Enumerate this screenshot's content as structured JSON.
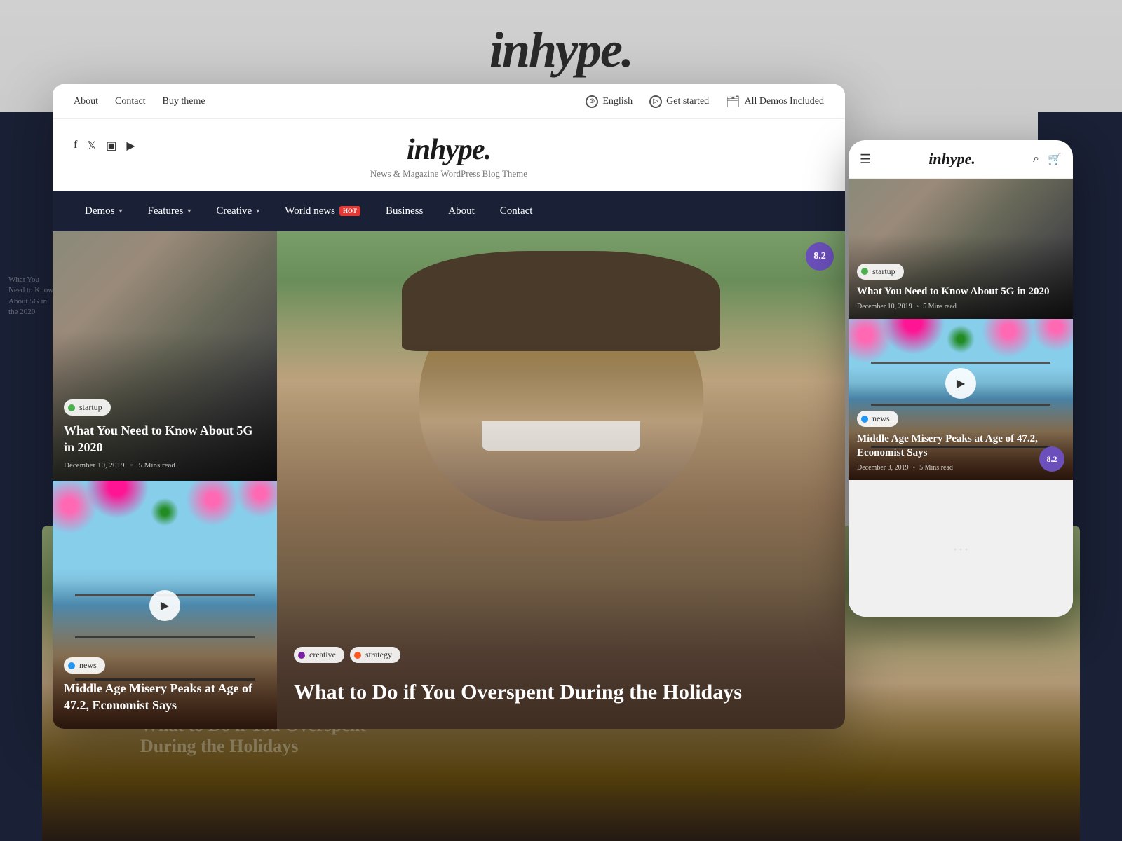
{
  "site": {
    "title": "inhype.",
    "tagline": "News & Magazine WordPress Blog Theme"
  },
  "background": {
    "title": "inhype.",
    "subtitle": "News & Magazine WordPress Blog Theme"
  },
  "utility_bar": {
    "links": [
      "About",
      "Contact",
      "Buy theme"
    ],
    "right_items": [
      {
        "icon": "globe-icon",
        "label": "English"
      },
      {
        "icon": "play-icon",
        "label": "Get started"
      },
      {
        "icon": "folder-icon",
        "label": "All Demos Included"
      }
    ]
  },
  "social": {
    "icons": [
      "facebook-icon",
      "twitter-icon",
      "instagram-icon",
      "youtube-icon"
    ]
  },
  "nav": {
    "items": [
      {
        "label": "Demos",
        "has_dropdown": true
      },
      {
        "label": "Features",
        "has_dropdown": true
      },
      {
        "label": "Creative",
        "has_dropdown": true
      },
      {
        "label": "World news",
        "has_hot": true
      },
      {
        "label": "Business",
        "has_dropdown": false
      },
      {
        "label": "About",
        "has_dropdown": false
      },
      {
        "label": "Contact",
        "has_dropdown": false
      }
    ],
    "hot_label": "HOT"
  },
  "articles": {
    "top_left": {
      "tag": "startup",
      "tag_color": "green",
      "title": "What You Need to Know About 5G in 2020",
      "date": "December 10, 2019",
      "read_time": "5 Mins read"
    },
    "bottom_left": {
      "tag": "news",
      "tag_color": "blue",
      "title": "Middle Age Misery Peaks at Age of 47.2, Economist Says",
      "date": "December 3, 2019",
      "read_time": "5 Mins read",
      "has_video": true
    },
    "main": {
      "tags": [
        {
          "label": "creative",
          "color": "purple"
        },
        {
          "label": "strategy",
          "color": "orange"
        }
      ],
      "title": "What to Do if You Overspent During the Holidays",
      "score": "8.2"
    }
  },
  "mobile": {
    "logo": "inhype.",
    "card1": {
      "tag": "startup",
      "tag_color": "green",
      "title": "What You Need to Know About 5G in 2020",
      "date": "December 10, 2019",
      "read_time": "5 Mins read"
    },
    "card2": {
      "tag": "news",
      "tag_color": "blue",
      "title": "Middle Age Misery Peaks at Age of 47.2, Economist Says",
      "date": "December 3, 2019",
      "read_time": "5 Mins read",
      "has_video": true,
      "score": "8.2"
    }
  },
  "colors": {
    "nav_bg": "#1a2035",
    "hot_badge": "#e53935",
    "score_badge": "#6B4FBB",
    "accent_blue": "#2196F3"
  }
}
